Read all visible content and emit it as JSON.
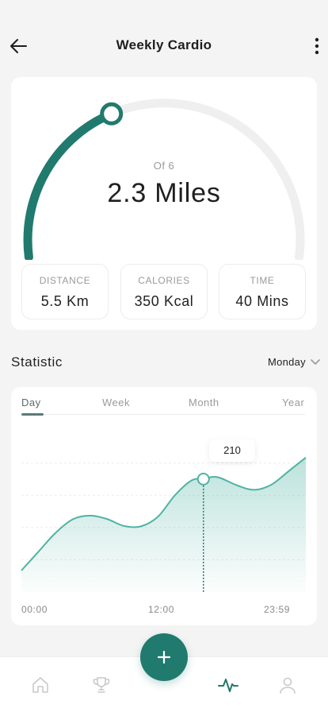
{
  "header": {
    "title": "Weekly Cardio",
    "back_icon": "arrow-left-icon",
    "menu_icon": "more-vertical-icon"
  },
  "progress": {
    "of_label": "Of 6",
    "value_label": "2.3 Miles",
    "current": 2.3,
    "goal": 6,
    "accent_color": "#217a6e",
    "track_color": "#efefef"
  },
  "stats": [
    {
      "label": "DISTANCE",
      "value": "5.5 Km"
    },
    {
      "label": "CALORIES",
      "value": "350 Kcal"
    },
    {
      "label": "TIME",
      "value": "40 Mins"
    }
  ],
  "statistic": {
    "title": "Statistic",
    "selected_day": "Monday",
    "dropdown_icon": "chevron-down-icon",
    "tabs": [
      "Day",
      "Week",
      "Month",
      "Year"
    ],
    "active_tab": "Day"
  },
  "chart_data": {
    "type": "area",
    "x_ticks": [
      "00:00",
      "12:00",
      "23:59"
    ],
    "x": [
      0,
      0.06,
      0.12,
      0.18,
      0.24,
      0.3,
      0.36,
      0.42,
      0.48,
      0.54,
      0.6,
      0.64,
      0.67,
      0.7,
      0.76,
      0.82,
      0.88,
      0.94,
      1.0
    ],
    "y": [
      40,
      75,
      110,
      135,
      142,
      136,
      123,
      122,
      140,
      180,
      208,
      210,
      214,
      212,
      198,
      190,
      200,
      225,
      250
    ],
    "highlight": {
      "x": 0.64,
      "value": 210,
      "label": "210"
    },
    "ylim": [
      0,
      300
    ],
    "grid": true,
    "color": "#4fb3a3"
  },
  "nav": {
    "items": [
      {
        "name": "home",
        "icon": "home-icon"
      },
      {
        "name": "trophy",
        "icon": "trophy-icon"
      },
      {
        "name": "activity",
        "icon": "activity-icon",
        "active": true
      },
      {
        "name": "profile",
        "icon": "user-icon"
      }
    ],
    "fab_icon": "plus-icon"
  }
}
